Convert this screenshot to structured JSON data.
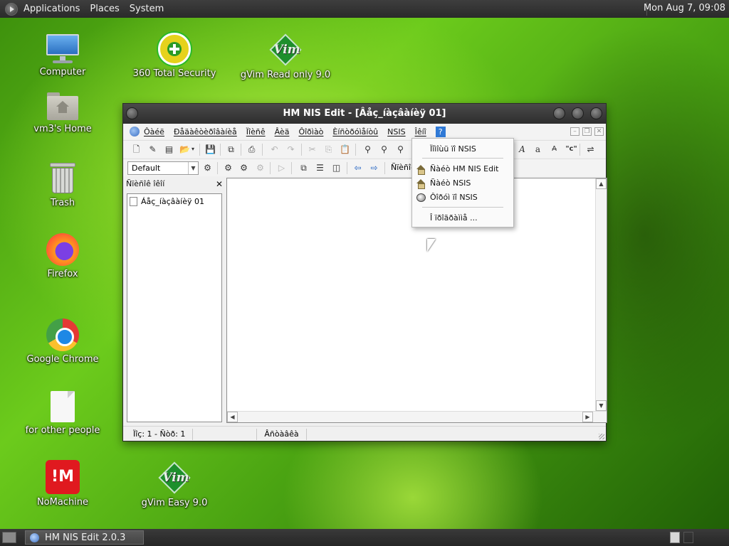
{
  "top_panel": {
    "menus": [
      "Applications",
      "Places",
      "System"
    ],
    "clock": "Mon Aug  7, 09:08"
  },
  "desktop": {
    "icons": [
      {
        "label": "Computer"
      },
      {
        "label": "360 Total Security"
      },
      {
        "label": "gVim Read only 9.0"
      },
      {
        "label": "vm3's Home"
      },
      {
        "label": "Trash"
      },
      {
        "label": "Firefox"
      },
      {
        "label": "Google Chrome"
      },
      {
        "label": "for other people"
      },
      {
        "label": "NoMachine"
      },
      {
        "label": "gVim Easy 9.0"
      }
    ]
  },
  "window": {
    "title": "HM NIS Edit - [Âåç_íàçâàíèÿ 01]",
    "menus": [
      "Ôàéë",
      "Ðåäàêòèðîâàíèå",
      "Ïîèñê",
      "Âèä",
      "Ôîðìàò",
      "Èíñòðóìåíòû",
      "NSIS",
      "Îêíî",
      "?"
    ],
    "toolbar": {
      "combo_value": "Default",
      "label_partial": "Ñïèñîê"
    },
    "left_panel": {
      "title": "Ñïèñîê îêîí",
      "close": "✕",
      "items": [
        "Áåç_íàçâàíèÿ 01"
      ]
    },
    "status": {
      "position": "Ïîç: 1 - Ñòð: 1",
      "mode": "Âñòàâêà"
    },
    "help_menu": {
      "items": [
        {
          "label": "Ïîìîùü ïî NSIS",
          "icon": "none"
        },
        {
          "label": "Ñàéò HM NIS Edit",
          "icon": "home-icon"
        },
        {
          "label": "Ñàéò NSIS",
          "icon": "home-icon"
        },
        {
          "label": "Ôîðóì ïî NSIS",
          "icon": "forum-icon"
        },
        {
          "label": "Î ïðîãðàììå ...",
          "icon": "none"
        }
      ]
    }
  },
  "taskbar": {
    "task_label": "HM NIS Edit 2.0.3"
  }
}
